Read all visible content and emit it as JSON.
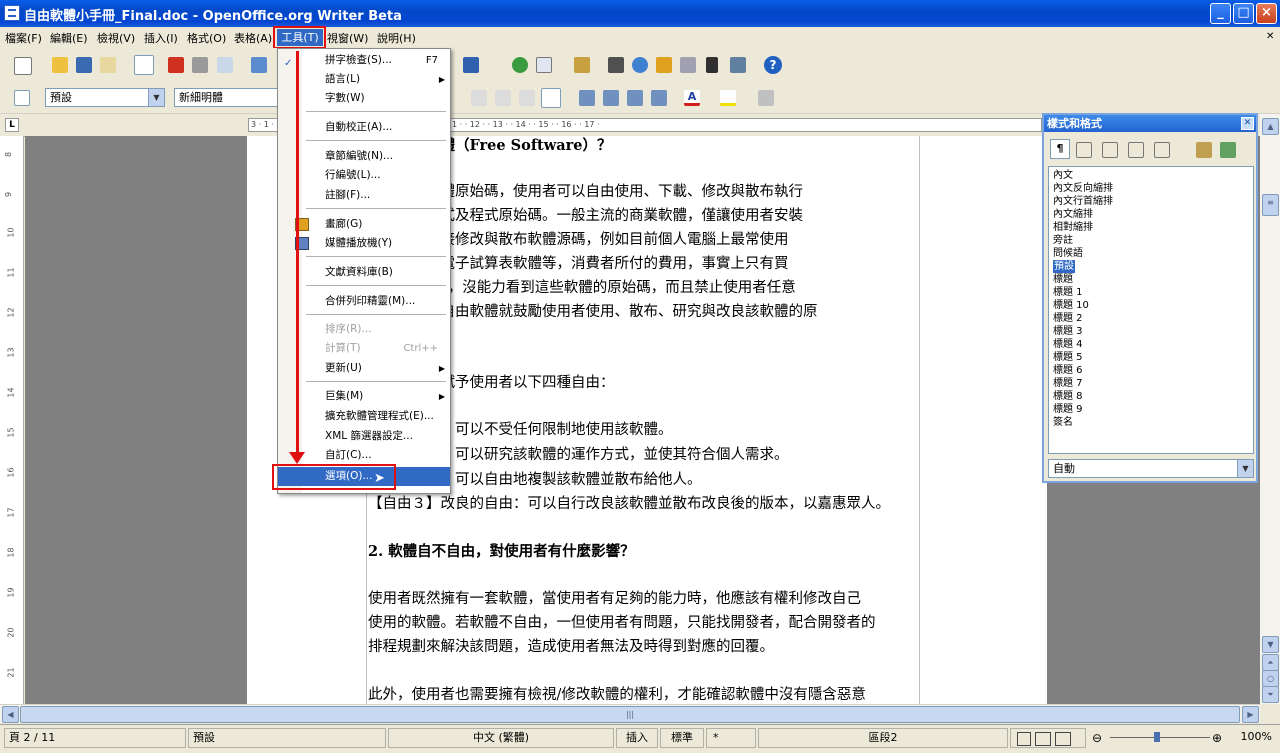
{
  "window": {
    "title": "自由軟體小手冊_Final.doc - OpenOffice.org Writer Beta"
  },
  "menubar": {
    "items": [
      "檔案(F)",
      "編輯(E)",
      "檢視(V)",
      "插入(I)",
      "格式(O)",
      "表格(A)",
      "工具(T)",
      "視窗(W)",
      "說明(H)"
    ],
    "active": "工具(T)"
  },
  "formatbar": {
    "paragraph_style": "預設",
    "font_name": "新細明體"
  },
  "ruler": {
    "marks": "3 · 1 · · 2 · · 3 · · 4 · · 5 · · 6 · · 7 · · 8 · · 9 · · 10 · · 11 · · 12 · · 13 · · 14 · · 15 · · 16 · · 17 ·"
  },
  "vruler": {
    "marks": [
      "8",
      "9",
      "10",
      "11",
      "12",
      "13",
      "14",
      "15",
      "16",
      "17",
      "18",
      "19",
      "20",
      "21"
    ]
  },
  "tools_menu": {
    "spelling": {
      "label": "拼字檢查(S)...",
      "shortcut": "F7"
    },
    "language": "語言(L)",
    "word_count": "字數(W)",
    "autocorrect": "自動校正(A)...",
    "outline_numbering": "章節編號(N)...",
    "line_numbering": "行編號(L)...",
    "footnotes": "註腳(F)...",
    "gallery": "畫廊(G)",
    "media_player": "媒體播放機(Y)",
    "bibliography": "文獻資料庫(B)",
    "mail_merge": "合併列印精靈(M)...",
    "sort": "排序(R)...",
    "calculate": {
      "label": "計算(T)",
      "shortcut": "Ctrl++"
    },
    "update": "更新(U)",
    "macros": "巨集(M)",
    "extension_manager": "擴充軟體管理程式(E)...",
    "xml_filters": "XML 篩選器設定...",
    "customize": "自訂(C)...",
    "options": "選項(O)..."
  },
  "document": {
    "lines": [
      "自由開放軟體（Free Software）？",
      "指公開的軟體原始碼，使用者可以自由使用、下載、修改與散布執行",
      "軟體執行程式及程式原始碼。一般主流的商業軟體，僅讓使用者安裝",
      "，但無法直接修改與散布軟體源碼，例如目前個人電腦上最常使用",
      "處理軟體與電子試算表軟體等，消費者所付的費用，事實上只有買",
      "的「使用權」，沒能力看到這些軟體的原始碼，而且禁止使用者任意",
      "。相較之下自由軟體就鼓勵使用者使用、散布、研究與改良該軟體的原",
      "，自由軟體賦予使用者以下四種自由：",
      "使用的自由：可以不受任何限制地使用該軟體。",
      "研究的自由：可以研究該軟體的運作方式，並使其符合個人需求。",
      "散布的自由：可以自由地複製該軟體並散布給他人。",
      "【自由３】改良的自由：可以自行改良該軟體並散布改良後的版本，以嘉惠眾人。",
      "2. 軟體自不自由，對使用者有什麼影響？",
      "使用者既然擁有一套軟體，當使用者有足夠的能力時，他應該有權利修改自己",
      "使用的軟體。若軟體不自由，一但使用者有問題，只能找開發者，配合開發者的",
      "排程規劃來解決該問題，造成使用者無法及時得到對應的回覆。",
      "此外，使用者也需要擁有檢視/修改軟體的權利，才能確認軟體中沒有隱含惡意"
    ]
  },
  "styles_panel": {
    "title": "樣式和格式",
    "styles": [
      "內文",
      "內文反向縮排",
      "內文行首縮排",
      "內文縮排",
      "相對縮排",
      "旁註",
      "問候語",
      "預設",
      "標題",
      "標題 1",
      "標題 10",
      "標題 2",
      "標題 3",
      "標題 4",
      "標題 5",
      "標題 6",
      "標題 7",
      "標題 8",
      "標題 9",
      "簽名"
    ],
    "selected": "預設",
    "filter": "自動"
  },
  "statusbar": {
    "page": "頁 2 / 11",
    "page_style": "預設",
    "language": "中文 (繁體)",
    "insert_mode": "插入",
    "selection_mode": "標準",
    "modified": "*",
    "section": "區段2",
    "zoom": "100%"
  },
  "colors": {
    "titlebar": "#0548d0",
    "highlight": "#316ac5",
    "annotation": "#e01010"
  }
}
